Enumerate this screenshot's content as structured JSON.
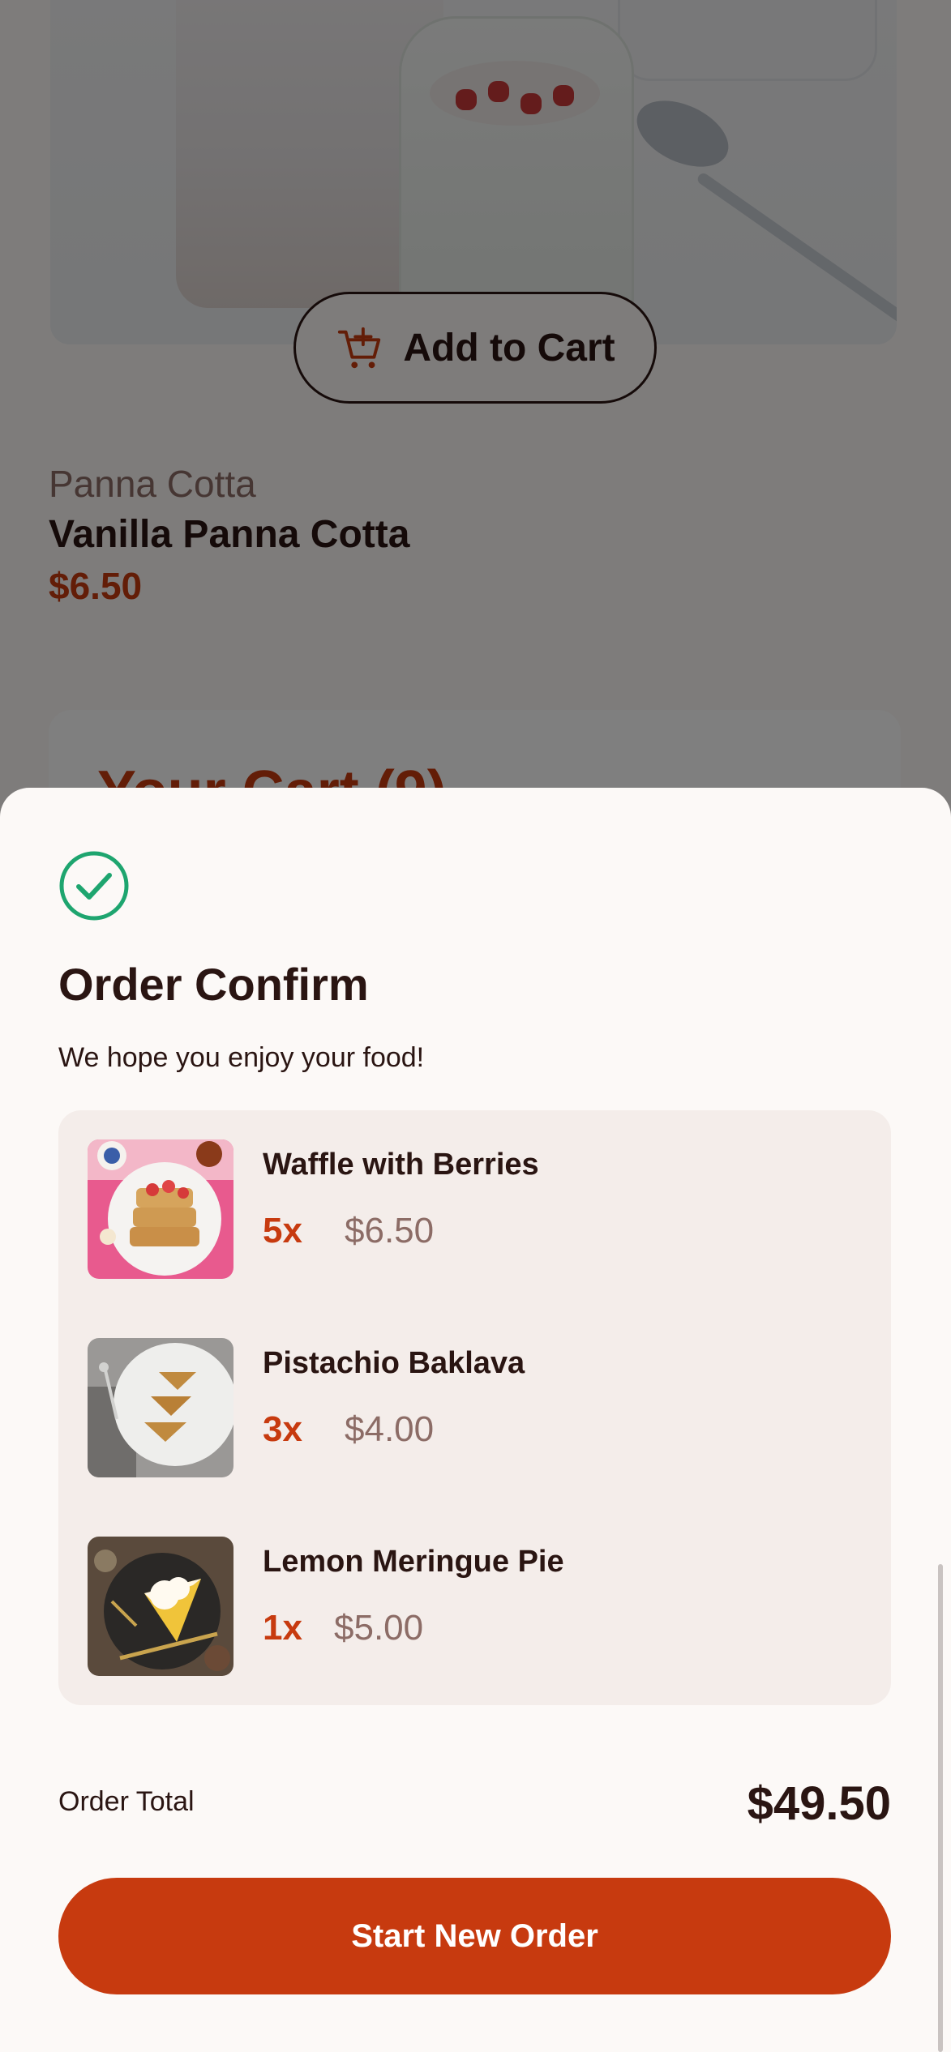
{
  "product": {
    "add_to_cart_label": "Add to Cart",
    "category": "Panna Cotta",
    "name": "Vanilla Panna Cotta",
    "price": "$6.50"
  },
  "cart": {
    "title": "Your Cart (9)"
  },
  "modal": {
    "title": "Order Confirm",
    "subtitle": "We hope you enjoy your food!",
    "items": [
      {
        "name": "Waffle with Berries",
        "quantity": "5x",
        "price": "$6.50"
      },
      {
        "name": "Pistachio Baklava",
        "quantity": "3x",
        "price": "$4.00"
      },
      {
        "name": "Lemon Meringue Pie",
        "quantity": "1x",
        "price": "$5.00"
      }
    ],
    "total_label": "Order Total",
    "total_value": "$49.50",
    "start_new_order_label": "Start New Order"
  },
  "icons": {
    "cart": "add-to-cart-icon",
    "confirm": "check-circle-icon"
  },
  "colors": {
    "accent": "#c73a0f",
    "text_dark": "#2a1512",
    "text_muted": "#8c6c66",
    "success": "#1ea56f",
    "sheet_bg": "#fcf9f7",
    "items_bg": "#f4edea"
  }
}
